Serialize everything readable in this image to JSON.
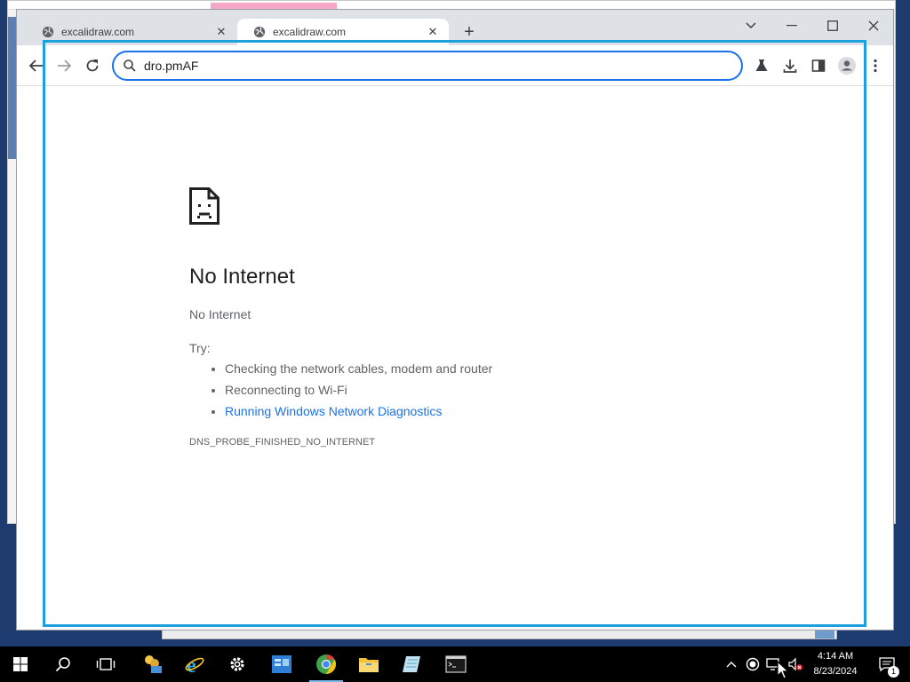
{
  "browser": {
    "tabs": [
      {
        "label": "excalidraw.com",
        "icon": "globe-icon",
        "active": false
      },
      {
        "label": "excalidraw.com",
        "icon": "globe-icon",
        "active": true
      }
    ],
    "new_tab_label": "+",
    "address": {
      "value": "dro.pmAF",
      "placeholder": ""
    },
    "accent_color": "#1a73e8"
  },
  "error_page": {
    "title": "No Internet",
    "subtitle": "No Internet",
    "try_label": "Try:",
    "suggestions": [
      {
        "text": "Checking the network cables, modem and router",
        "link": false
      },
      {
        "text": "Reconnecting to Wi-Fi",
        "link": false
      },
      {
        "text": "Running Windows Network Diagnostics",
        "link": true
      }
    ],
    "error_code": "DNS_PROBE_FINISHED_NO_INTERNET"
  },
  "taskbar": {
    "apps": [
      "windows-start-icon",
      "search-icon",
      "task-view-icon",
      "people-icon",
      "internet-explorer-icon",
      "settings-gear-icon",
      "server-manager-icon",
      "chrome-icon",
      "file-explorer-icon",
      "notepad-icon",
      "terminal-icon"
    ],
    "clock": {
      "time": "4:14 AM",
      "date": "8/23/2024"
    },
    "notification_count": "1"
  }
}
